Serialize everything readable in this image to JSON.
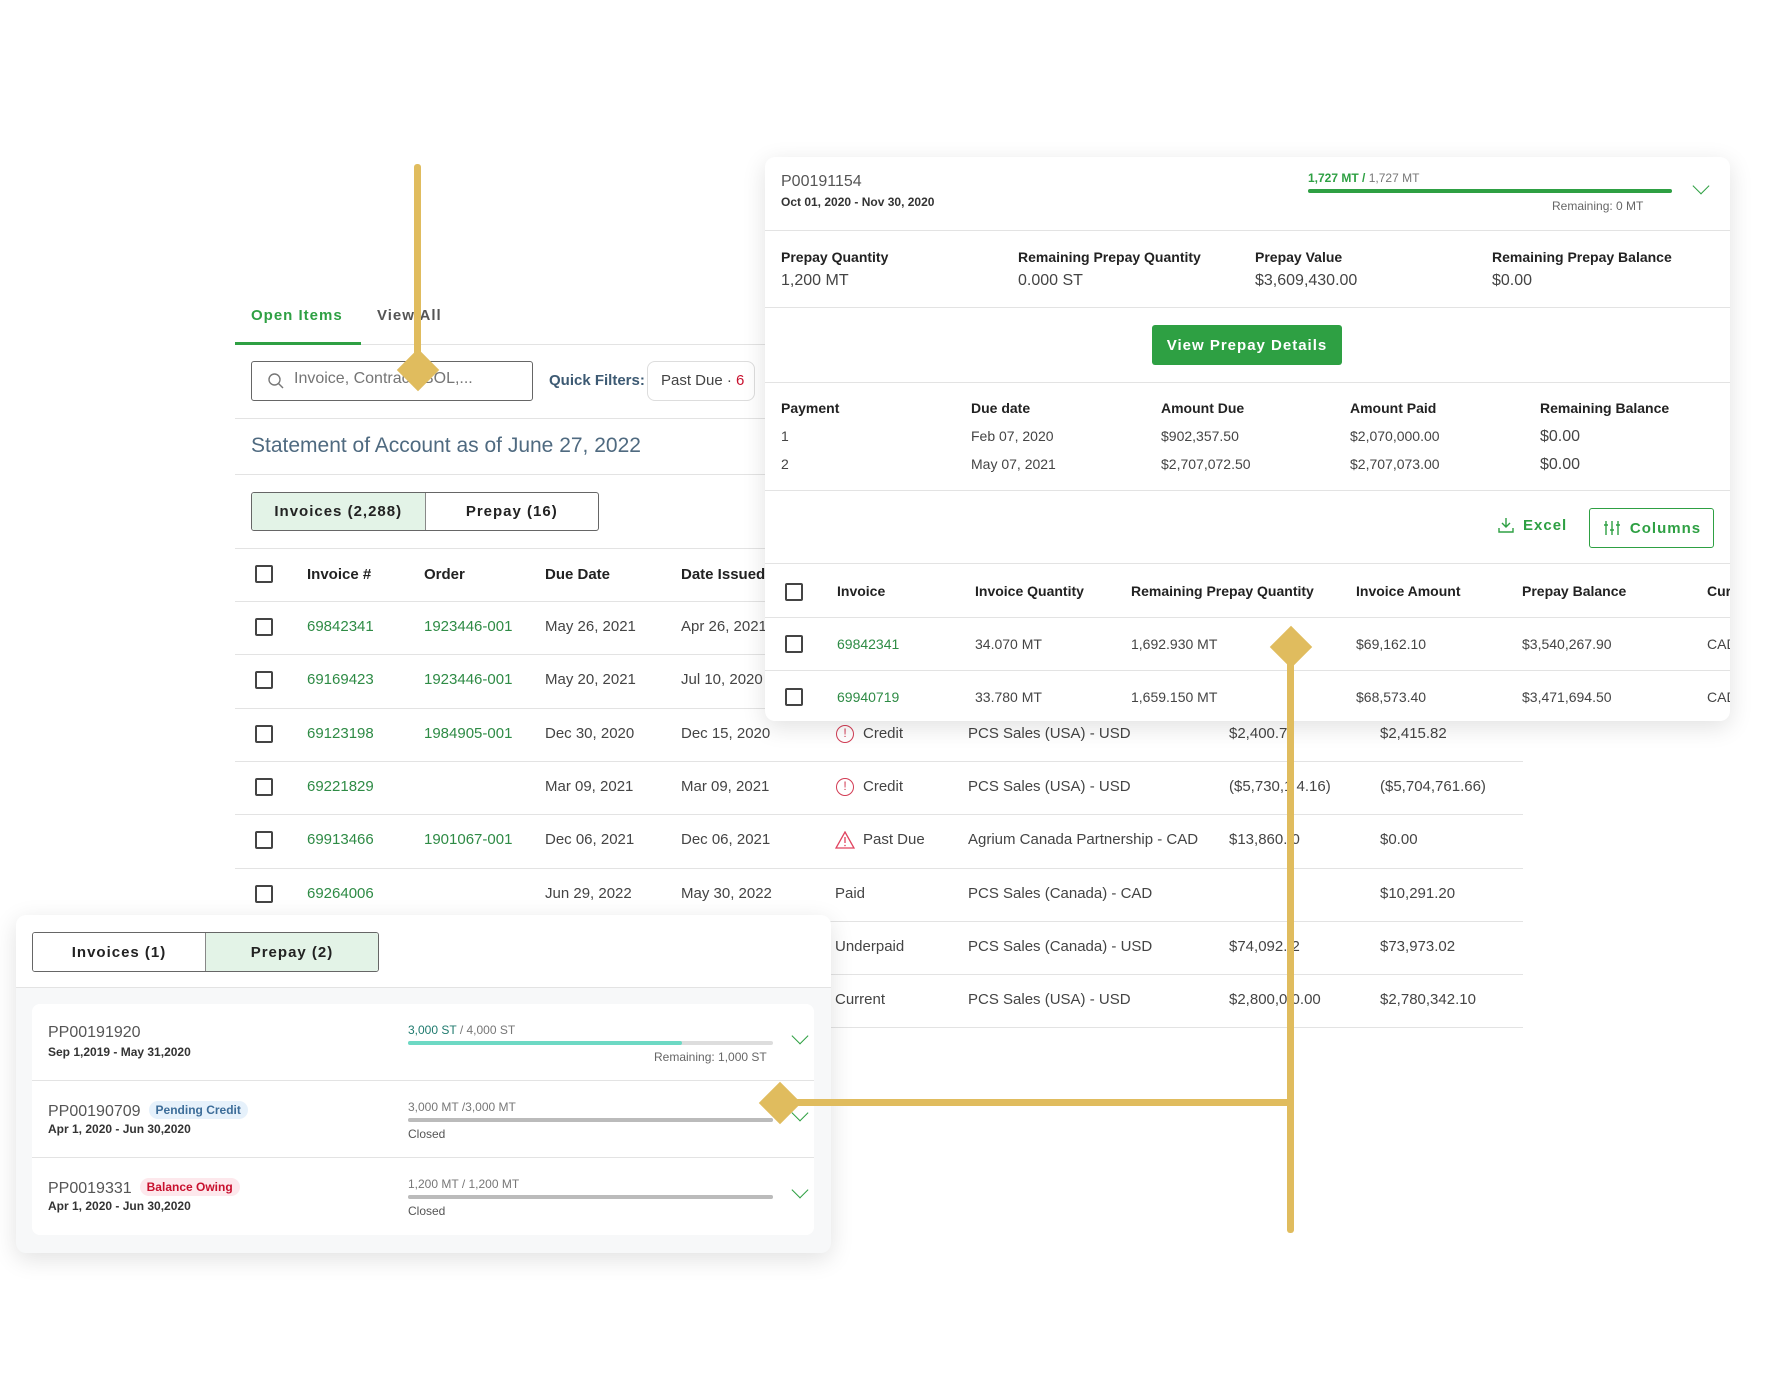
{
  "main": {
    "tabs": [
      {
        "label": "Open Items",
        "active": true
      },
      {
        "label": "View All",
        "active": false
      }
    ],
    "search": {
      "placeholder": "Invoice, Contract, BOL,..."
    },
    "quick_filters": {
      "label": "Quick Filters:",
      "pill_label": "Past Due · ",
      "pill_count": "6"
    },
    "statement_title": "Statement of Account as of June 27, 2022",
    "segments": [
      {
        "label": "Invoices (2,288)",
        "active": true
      },
      {
        "label": "Prepay (16)",
        "active": false
      }
    ],
    "table": {
      "columns": [
        "Invoice #",
        "Order",
        "Due Date",
        "Date Issued"
      ],
      "rows": [
        {
          "invoice": "69842341",
          "order": "1923446-001",
          "due": "May 26, 2021",
          "issued": "Apr 26, 2021",
          "status": "",
          "status_icon": "",
          "account": "",
          "amount": "",
          "balance": ""
        },
        {
          "invoice": "69169423",
          "order": "1923446-001",
          "due": "May 20, 2021",
          "issued": "Jul 10, 2020",
          "status": "",
          "status_icon": "",
          "account": "",
          "amount": "",
          "balance": ""
        },
        {
          "invoice": "69123198",
          "order": "1984905-001",
          "due": "Dec 30, 2020",
          "issued": "Dec 15, 2020",
          "status": "Credit",
          "status_icon": "alert-circle-icon",
          "account": "PCS Sales (USA) - USD",
          "amount": "$2,400.7",
          "balance": "$2,415.82"
        },
        {
          "invoice": "69221829",
          "order": "",
          "due": "Mar 09, 2021",
          "issued": "Mar 09, 2021",
          "status": "Credit",
          "status_icon": "alert-circle-icon",
          "account": "PCS Sales (USA) - USD",
          "amount": "($5,730,1 4.16)",
          "balance": "($5,704,761.66)"
        },
        {
          "invoice": "69913466",
          "order": "1901067-001",
          "due": "Dec 06, 2021",
          "issued": "Dec 06, 2021",
          "status": "Past Due",
          "status_icon": "warning-triangle-icon",
          "account": "Agrium Canada Partnership - CAD",
          "amount": "$13,860.  0",
          "balance": "$0.00"
        },
        {
          "invoice": "69264006",
          "order": "",
          "due": "Jun 29, 2022",
          "issued": "May 30, 2022",
          "status": "Paid",
          "status_icon": "",
          "account": "PCS Sales (Canada) - CAD",
          "amount": "",
          "balance": "$10,291.20"
        },
        {
          "invoice": "",
          "order": "",
          "due": "",
          "issued": "",
          "status": "Underpaid",
          "status_icon": "",
          "account": "PCS Sales (Canada) - USD",
          "amount": "$74,092.  2",
          "balance": "$73,973.02"
        },
        {
          "invoice": "",
          "order": "",
          "due": "",
          "issued": "",
          "status": "Current",
          "status_icon": "",
          "account": "PCS Sales (USA) - USD",
          "amount": "$2,800,0  0.00",
          "balance": "$2,780,342.10"
        }
      ]
    }
  },
  "prepay_detail": {
    "id": "P00191154",
    "dates": "Oct 01, 2020 - Nov 30, 2020",
    "progress": {
      "used": "1,727 MT",
      "separator": " / ",
      "total": "1,727 MT",
      "fraction": 1.0,
      "remaining": "Remaining: 0 MT"
    },
    "summary": [
      {
        "label": "Prepay Quantity",
        "value": "1,200 MT"
      },
      {
        "label": "Remaining Prepay Quantity",
        "value": "0.000 ST"
      },
      {
        "label": "Prepay Value",
        "value": "$3,609,430.00"
      },
      {
        "label": "Remaining Prepay Balance",
        "value": "$0.00"
      }
    ],
    "view_button": "View Prepay Details",
    "payments": {
      "columns": [
        "Payment",
        "Due date",
        "Amount Due",
        "Amount Paid",
        "Remaining Balance"
      ],
      "rows": [
        [
          "1",
          "Feb 07, 2020",
          "$902,357.50",
          "$2,070,000.00",
          "$0.00"
        ],
        [
          "2",
          "May 07, 2021",
          "$2,707,072.50",
          "$2,707,073.00",
          "$0.00"
        ]
      ]
    },
    "excel_label": "Excel",
    "columns_label": "Columns",
    "invoices": {
      "columns": [
        "Invoice",
        "Invoice Quantity",
        "Remaining Prepay Quantity",
        "Invoice Amount",
        "Prepay Balance",
        "Curre"
      ],
      "rows": [
        [
          "69842341",
          "34.070 MT",
          "1,692.930 MT",
          "$69,162.10",
          "$3,540,267.90",
          "CAD"
        ],
        [
          "69940719",
          "33.780 MT",
          "1,659.150 MT",
          "$68,573.40",
          "$3,471,694.50",
          "CAD"
        ]
      ]
    }
  },
  "prepay_list": {
    "segments": [
      {
        "label": "Invoices (1)",
        "active": false
      },
      {
        "label": "Prepay (2)",
        "active": true
      }
    ],
    "items": [
      {
        "id": "PP00191920",
        "badge": "",
        "badge_type": "",
        "dates": "Sep 1,2019 - May 31,2020",
        "used": "3,000 ST",
        "sep": " / ",
        "total": "4,000 ST",
        "fraction": 0.75,
        "status": "Remaining: 1,000 ST",
        "fill_color": "#6dd9c4"
      },
      {
        "id": "PP00190709",
        "badge": "Pending Credit",
        "badge_type": "info",
        "dates": "Apr 1, 2020 - Jun 30,2020",
        "used": "3,000 MT",
        "sep": " /",
        "total": "3,000 MT",
        "fraction": 1.0,
        "status": "Closed",
        "fill_color": "#bbbbbb"
      },
      {
        "id": "PP0019331",
        "badge": "Balance Owing",
        "badge_type": "danger",
        "dates": "Apr 1, 2020 - Jun 30,2020",
        "used": "1,200 MT",
        "sep": " / ",
        "total": "1,200 MT",
        "fraction": 1.0,
        "status": "Closed",
        "fill_color": "#bbbbbb"
      }
    ]
  },
  "colors": {
    "brand_green": "#2ea043",
    "link_green": "#2e8b45",
    "danger": "#c8102e",
    "connector": "#e0bc5e"
  }
}
